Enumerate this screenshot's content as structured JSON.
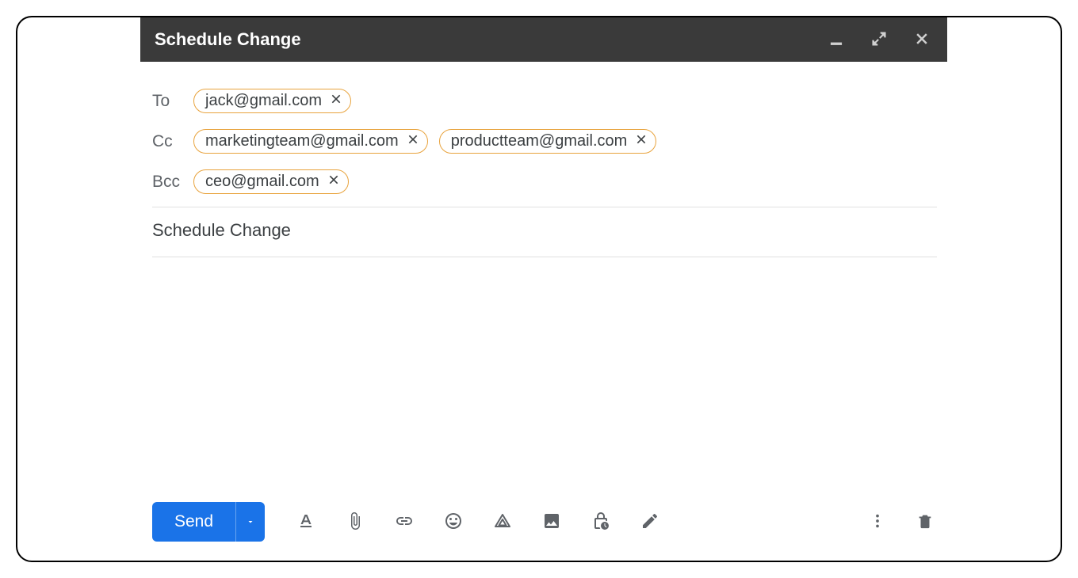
{
  "header": {
    "title": "Schedule Change"
  },
  "fields": {
    "to_label": "To",
    "cc_label": "Cc",
    "bcc_label": "Bcc",
    "to": [
      "jack@gmail.com"
    ],
    "cc": [
      "marketingteam@gmail.com",
      "productteam@gmail.com"
    ],
    "bcc": [
      "ceo@gmail.com"
    ]
  },
  "subject": "Schedule Change",
  "toolbar": {
    "send_label": "Send"
  }
}
